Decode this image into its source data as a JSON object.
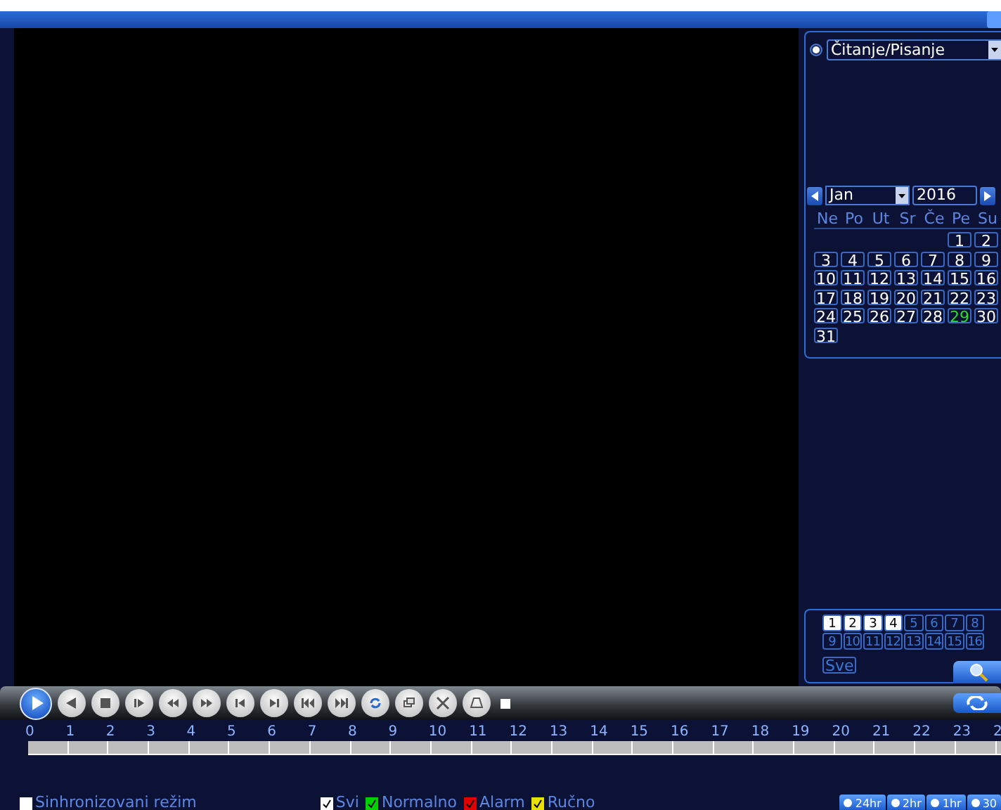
{
  "mode": {
    "selected": true,
    "value": "Čitanje/Pisanje"
  },
  "calendar": {
    "month": "Jan",
    "year": "2016",
    "weekdays": [
      "Ne",
      "Po",
      "Ut",
      "Sr",
      "Če",
      "Pe",
      "Su"
    ],
    "days": [
      {
        "day": "1",
        "recorded": false
      },
      {
        "day": "2",
        "recorded": false
      },
      {
        "day": "3",
        "recorded": false
      },
      {
        "day": "4",
        "recorded": false
      },
      {
        "day": "5",
        "recorded": false
      },
      {
        "day": "6",
        "recorded": false
      },
      {
        "day": "7",
        "recorded": false
      },
      {
        "day": "8",
        "recorded": false
      },
      {
        "day": "9",
        "recorded": false
      },
      {
        "day": "10",
        "recorded": false
      },
      {
        "day": "11",
        "recorded": false
      },
      {
        "day": "12",
        "recorded": false
      },
      {
        "day": "13",
        "recorded": false
      },
      {
        "day": "14",
        "recorded": false
      },
      {
        "day": "15",
        "recorded": false
      },
      {
        "day": "16",
        "recorded": false
      },
      {
        "day": "17",
        "recorded": false
      },
      {
        "day": "18",
        "recorded": false
      },
      {
        "day": "19",
        "recorded": false
      },
      {
        "day": "20",
        "recorded": false
      },
      {
        "day": "21",
        "recorded": false
      },
      {
        "day": "22",
        "recorded": false
      },
      {
        "day": "23",
        "recorded": false
      },
      {
        "day": "24",
        "recorded": false
      },
      {
        "day": "25",
        "recorded": false
      },
      {
        "day": "26",
        "recorded": false
      },
      {
        "day": "27",
        "recorded": false
      },
      {
        "day": "28",
        "recorded": false
      },
      {
        "day": "29",
        "recorded": true
      },
      {
        "day": "30",
        "recorded": false
      },
      {
        "day": "31",
        "recorded": false
      }
    ]
  },
  "channels": [
    {
      "label": "1",
      "selected": true
    },
    {
      "label": "2",
      "selected": true
    },
    {
      "label": "3",
      "selected": true
    },
    {
      "label": "4",
      "selected": true
    },
    {
      "label": "5",
      "selected": false
    },
    {
      "label": "6",
      "selected": false
    },
    {
      "label": "7",
      "selected": false
    },
    {
      "label": "8",
      "selected": false
    },
    {
      "label": "9",
      "selected": false
    },
    {
      "label": "10",
      "selected": false
    },
    {
      "label": "11",
      "selected": false
    },
    {
      "label": "12",
      "selected": false
    },
    {
      "label": "13",
      "selected": false
    },
    {
      "label": "14",
      "selected": false
    },
    {
      "label": "15",
      "selected": false
    },
    {
      "label": "16",
      "selected": false
    }
  ],
  "all_channels_button": "Sve",
  "timeline": {
    "hours": [
      "0",
      "1",
      "2",
      "3",
      "4",
      "5",
      "6",
      "7",
      "8",
      "9",
      "10",
      "11",
      "12",
      "13",
      "14",
      "15",
      "16",
      "17",
      "18",
      "19",
      "20",
      "21",
      "22",
      "23",
      "2"
    ]
  },
  "sync_mode": {
    "label": "Sinhronizovani režim",
    "checked": false
  },
  "legend": [
    {
      "label": "Svi",
      "checked": true,
      "color": "#ffffff"
    },
    {
      "label": "Normalno",
      "checked": true,
      "color": "#00d000"
    },
    {
      "label": "Alarm",
      "checked": true,
      "color": "#e00000"
    },
    {
      "label": "Ručno",
      "checked": true,
      "color": "#e8e000"
    }
  ],
  "zoom_buttons": [
    "24hr",
    "2hr",
    "1hr",
    "30"
  ]
}
